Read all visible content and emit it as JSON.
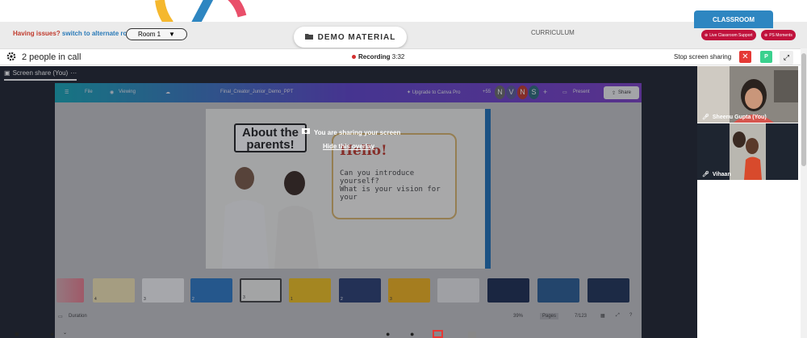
{
  "top": {
    "issues_question": "Having issues?",
    "issues_action": "switch to alternate room",
    "room_value": "Room 1",
    "demo_material": "DEMO MATERIAL",
    "curriculum": "CURRICULUM",
    "classroom": "CLASSROOM",
    "live_support": "Live Classroom Support",
    "ps_moments": "PS Moments"
  },
  "call": {
    "people_text": "2 people in call",
    "recording_label": "Recording",
    "recording_time": "3:32",
    "stop_share": "Stop screen sharing",
    "p_badge": "P"
  },
  "share": {
    "tab_label": "Screen share (You)",
    "tab_more": "···",
    "overlay_text": "You are sharing your screen",
    "overlay_link": "Hide this overlay"
  },
  "canva": {
    "file": "File",
    "viewing": "Viewing",
    "doc_title": "Final_Creator_Junior_Demo_PPT",
    "upgrade": "Upgrade to Canva Pro",
    "avatar_count": "+55",
    "avatars": [
      "N",
      "V",
      "N",
      "S"
    ],
    "present": "Present",
    "share_btn": "Share",
    "slide_title": "About the parents!",
    "hello": "Hello!",
    "q1": "Can you introduce yourself?",
    "q2": "What is your vision for your",
    "thumb_labels": [
      "",
      "4",
      "3",
      "2",
      "3",
      "1",
      "2",
      "3",
      "",
      "",
      "",
      "",
      ""
    ],
    "duration": "Duration",
    "zoom": "39%",
    "pages": "Pages",
    "page_count": "7/123"
  },
  "participants": [
    {
      "name": "Sheenu Gupta (You)"
    },
    {
      "name": "Vihaan"
    }
  ],
  "colors": {
    "accent": "#2e86c1",
    "record": "#d32f2f",
    "danger": "#e53935",
    "badge_green": "#3ad18e",
    "pill": "#c0123c"
  }
}
